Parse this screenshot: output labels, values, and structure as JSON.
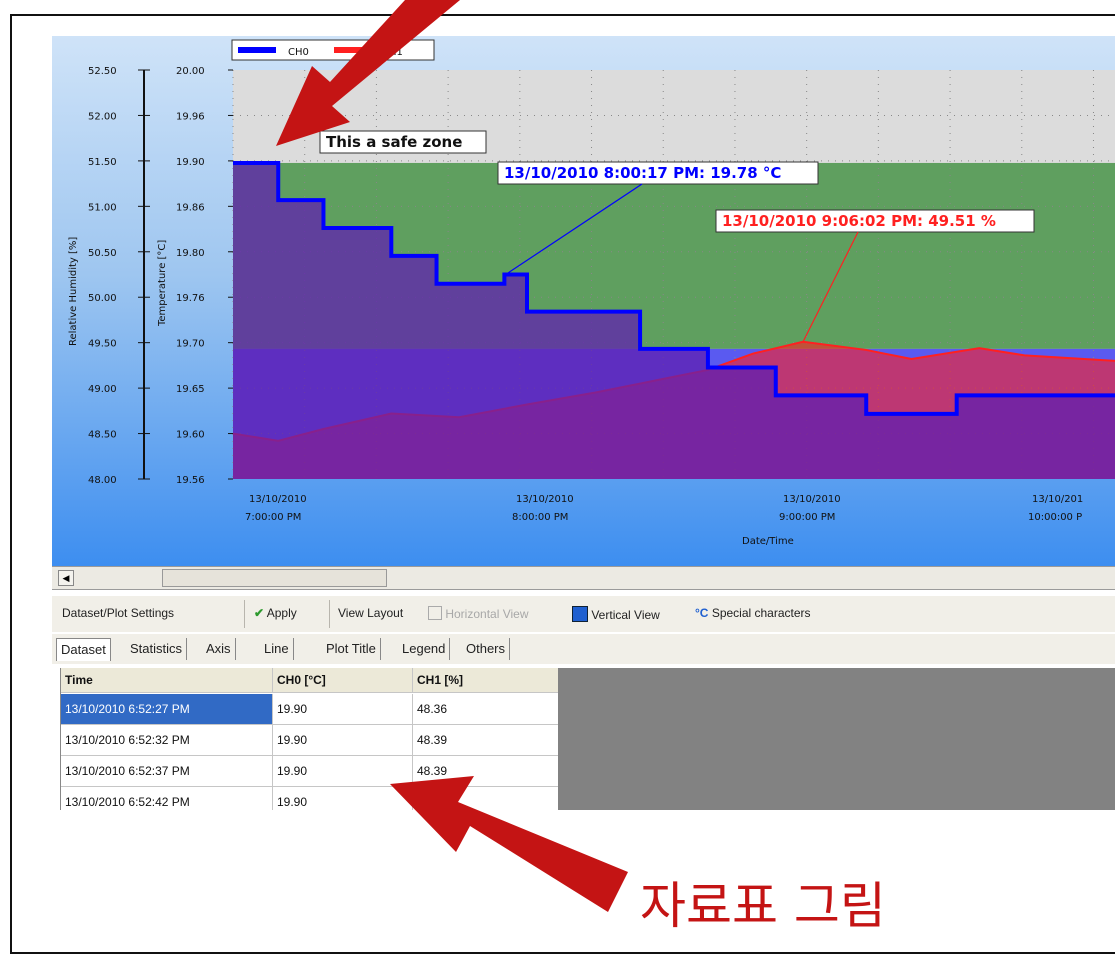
{
  "chart": {
    "legend": [
      "CH0",
      "CH1"
    ],
    "left_axis_title": "Relative Humidity [%]",
    "right_axis_title": "Temperature [°C]",
    "x_axis_title": "Date/Time",
    "humidity_ticks": [
      "52.50",
      "52.00",
      "51.50",
      "51.00",
      "50.50",
      "50.00",
      "49.50",
      "49.00",
      "48.50",
      "48.00"
    ],
    "temp_ticks": [
      "20.00",
      "19.96",
      "19.90",
      "19.86",
      "19.80",
      "19.76",
      "19.70",
      "19.65",
      "19.60",
      "19.56"
    ],
    "x_ticks": [
      {
        "date": "13/10/2010",
        "time": "7:00:00 PM"
      },
      {
        "date": "13/10/2010",
        "time": "8:00:00 PM"
      },
      {
        "date": "13/10/2010",
        "time": "9:00:00 PM"
      },
      {
        "date": "13/10/201",
        "time": "10:00:00 P"
      }
    ],
    "safe_zone_label": "This a safe zone",
    "ch0_callout": "13/10/2010 8:00:17 PM: 19.78 °C",
    "ch1_callout": "13/10/2010 9:06:02 PM: 49.51 %",
    "colors": {
      "ch0": "#0000ff",
      "ch1": "#ff2020",
      "safe_zone": "#5f9f5f",
      "below_zone": "#5a5af0",
      "overlap": "#6020b0",
      "plot_bg": "#dcdcdc",
      "arrow": "#c41414"
    }
  },
  "chart_data": {
    "type": "line",
    "xlabel": "Date/Time",
    "ylabel": "Temperature [°C]",
    "y2label": "Relative Humidity [%]",
    "ylim": [
      19.56,
      20.0
    ],
    "y2lim": [
      48.0,
      52.5
    ],
    "x_range": [
      "13/10/2010 7:00:00 PM",
      "13/10/2010 10:15:00 PM"
    ],
    "legend_position": "top-left",
    "grid": true,
    "series": [
      {
        "name": "CH0",
        "axis": "temperature",
        "x": [
          "13/10/2010 7:00:00 PM",
          "13/10/2010 7:05:00 PM",
          "13/10/2010 7:10:00 PM",
          "13/10/2010 7:20:00 PM",
          "13/10/2010 7:35:00 PM",
          "13/10/2010 7:45:00 PM",
          "13/10/2010 7:55:00 PM",
          "13/10/2010 8:00:00 PM",
          "13/10/2010 8:05:00 PM",
          "13/10/2010 8:20:00 PM",
          "13/10/2010 8:30:00 PM",
          "13/10/2010 8:40:00 PM",
          "13/10/2010 8:45:00 PM",
          "13/10/2010 9:00:00 PM",
          "13/10/2010 9:10:00 PM",
          "13/10/2010 9:20:00 PM",
          "13/10/2010 9:40:00 PM",
          "13/10/2010 10:15:00 PM"
        ],
        "values": [
          19.9,
          19.9,
          19.86,
          19.83,
          19.8,
          19.77,
          19.77,
          19.78,
          19.74,
          19.74,
          19.7,
          19.7,
          19.68,
          19.65,
          19.65,
          19.63,
          19.65,
          19.65
        ]
      },
      {
        "name": "CH1",
        "axis": "humidity",
        "x": [
          "13/10/2010 7:00:00 PM",
          "13/10/2010 7:10:00 PM",
          "13/10/2010 7:20:00 PM",
          "13/10/2010 7:35:00 PM",
          "13/10/2010 7:50:00 PM",
          "13/10/2010 8:05:00 PM",
          "13/10/2010 8:20:00 PM",
          "13/10/2010 8:35:00 PM",
          "13/10/2010 8:45:00 PM",
          "13/10/2010 8:55:00 PM",
          "13/10/2010 9:06:02 PM",
          "13/10/2010 9:20:00 PM",
          "13/10/2010 9:30:00 PM",
          "13/10/2010 9:45:00 PM",
          "13/10/2010 9:55:00 PM",
          "13/10/2010 10:15:00 PM"
        ],
        "values": [
          48.5,
          48.42,
          48.55,
          48.72,
          48.68,
          48.82,
          48.95,
          49.1,
          49.2,
          49.38,
          49.51,
          49.42,
          49.32,
          49.44,
          49.36,
          49.3
        ]
      }
    ],
    "bands": [
      {
        "label": "This a safe zone",
        "axis": "temperature",
        "from": 19.7,
        "to": 19.9
      }
    ],
    "annotations": [
      {
        "text": "13/10/2010 8:00:17 PM: 19.78 °C",
        "series": "CH0",
        "x": "13/10/2010 8:00:17 PM",
        "y": 19.78
      },
      {
        "text": "13/10/2010 9:06:02 PM: 49.51 %",
        "series": "CH1",
        "x": "13/10/2010 9:06:02 PM",
        "y": 49.51
      }
    ]
  },
  "toolbar": {
    "section_label": "Dataset/Plot Settings",
    "apply_label": "Apply",
    "view_layout_label": "View Layout",
    "horizontal_view_label": "Horizontal View",
    "vertical_view_label": "Vertical View",
    "special_chars_label": "Special characters"
  },
  "tabs": [
    "Dataset",
    "Statistics",
    "Axis",
    "Line",
    "Plot Title",
    "Legend",
    "Others"
  ],
  "grid": {
    "headers": [
      "Time",
      "CH0 [°C]",
      "CH1 [%]"
    ],
    "rows": [
      [
        "13/10/2010 6:52:27 PM",
        "19.90",
        "48.36"
      ],
      [
        "13/10/2010 6:52:32 PM",
        "19.90",
        "48.39"
      ],
      [
        "13/10/2010 6:52:37 PM",
        "19.90",
        "48.39"
      ],
      [
        "13/10/2010 6:52:42 PM",
        "19.90",
        ""
      ]
    ]
  },
  "caption": "자료표 그림"
}
